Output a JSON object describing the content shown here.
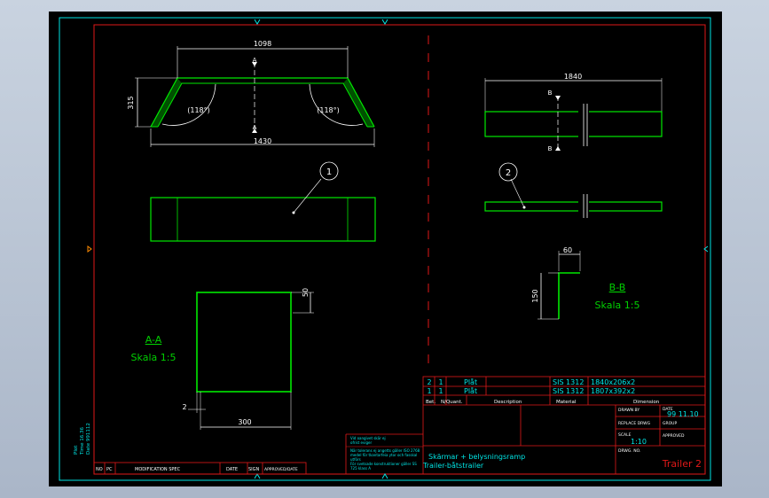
{
  "colors": {
    "viewport_bg": "#000000",
    "border": "#00e5e5",
    "red": "#e01818",
    "green": "#00e800",
    "dim": "#ffffff",
    "text": "#00e5e5",
    "label_green": "#00d000",
    "marker": "#ff8a00"
  },
  "part1": {
    "top_dim": "1098",
    "bottom_dim": "1430",
    "height_dim": "315",
    "angle_left": "(118°)",
    "angle_right": "(118°)",
    "section_label": "A",
    "balloon": "1"
  },
  "part2": {
    "top_dim": "1840",
    "section_label": "B",
    "balloon": "2"
  },
  "section_aa": {
    "title": "A-A",
    "scale": "Skala 1:5",
    "dim_height": "50",
    "dim_width": "300",
    "dim_gap": "2"
  },
  "section_bb": {
    "title": "B-B",
    "scale": "Skala 1:5",
    "dim_width": "60",
    "dim_height": "150"
  },
  "parts_list": {
    "rows": [
      {
        "pos": "2",
        "qty": "1",
        "desc": "Plåt",
        "material": "SIS 1312",
        "dimension": "1840x206x2"
      },
      {
        "pos": "1",
        "qty": "1",
        "desc": "Plåt",
        "material": "SIS 1312",
        "dimension": "1807x392x2"
      }
    ],
    "headers": {
      "pos": "Bet.",
      "qty": "N/Quant.",
      "desc": "Description",
      "material": "Material",
      "dimension": "Dimension"
    }
  },
  "title_block": {
    "drawn_by": "DRAWN BY",
    "date_label": "DATE",
    "date": "99 11.10",
    "replace_label": "REPLACE DRWG",
    "group_label": "GROUP",
    "scale_label": "SCALE",
    "scale": "1:10",
    "approved_label": "APPROVED",
    "drwg_label": "DRWG. NO.",
    "drwg_no": "Trailer 2",
    "title_line1": "Skärmar + belysningsramp",
    "title_line2": "Trailer-båtstrailer",
    "notes_line1": "Vid oangivet skär ej",
    "notes_line2": "ofrist eviger",
    "notes_line3": "När tolerans ej angetts gäller ISO 2768",
    "notes_line4": "medel för tkantarfeia ytor och fasskal",
    "notes_line5": "utförs",
    "notes_line6": "För svetsade konstruktioner gäller SS",
    "notes_line7": "725 klass A"
  },
  "revision_block": {
    "no": "NO",
    "pc": "PC",
    "modification": "MODIFICATION SPEC",
    "date": "DATE",
    "sign": "SIGN",
    "approved": "APPROVED/DATE"
  },
  "plot_info": {
    "line1": "Plot",
    "line2": "Time 16.36",
    "line3": "Date 991112"
  }
}
